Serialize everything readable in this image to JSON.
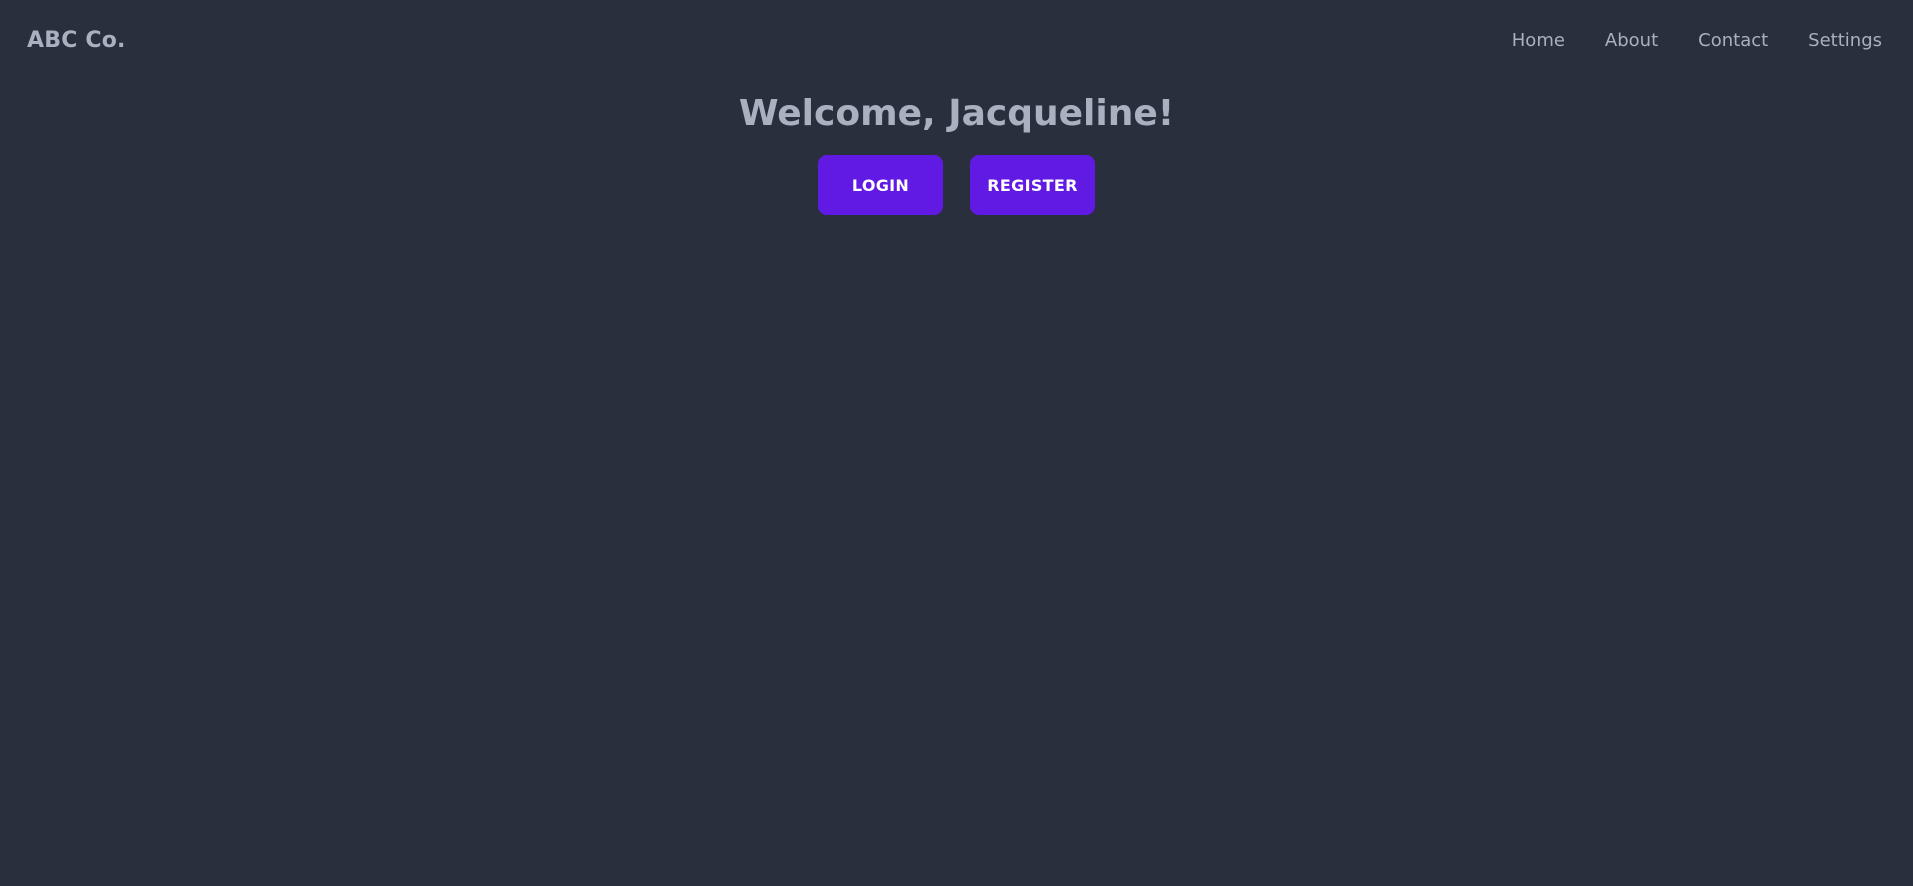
{
  "header": {
    "brand": "ABC Co.",
    "nav": [
      {
        "label": "Home"
      },
      {
        "label": "About"
      },
      {
        "label": "Contact"
      },
      {
        "label": "Settings"
      }
    ]
  },
  "main": {
    "title": "Welcome, Jacqueline!",
    "login_label": "LOGIN",
    "register_label": "REGISTER"
  },
  "colors": {
    "background": "#2a2f3d",
    "text_muted": "#a9b0bf",
    "accent": "#6119e4",
    "button_text": "#ffffff"
  }
}
